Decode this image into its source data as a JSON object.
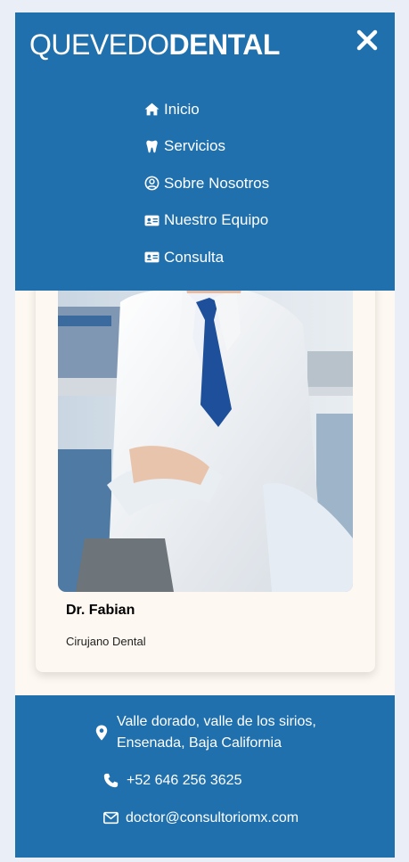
{
  "brand": {
    "logo_light": "QUEVEDO",
    "logo_bold": "DENTAL"
  },
  "nav": {
    "close_icon": "close-x-icon",
    "items": [
      {
        "label": "Inicio",
        "icon": "home-icon"
      },
      {
        "label": "Servicios",
        "icon": "tooth-icon"
      },
      {
        "label": "Sobre Nosotros",
        "icon": "user-circle-icon"
      },
      {
        "label": "Nuestro Equipo",
        "icon": "id-card-icon"
      },
      {
        "label": "Consulta",
        "icon": "id-card-icon"
      }
    ]
  },
  "team_card": {
    "photo": "doctor-photo",
    "name": "Dr. Fabian",
    "role": "Cirujano Dental"
  },
  "footer": {
    "address_line1": "Valle dorado, valle de los sirios,",
    "address_line2": "Ensenada, Baja California",
    "phone": "+52 646 256 3625",
    "email": "doctor@consultoriomx.com"
  },
  "colors": {
    "primary": "#1f70ad",
    "page_background": "#e9eef7",
    "card_background": "#fdf8f1"
  }
}
